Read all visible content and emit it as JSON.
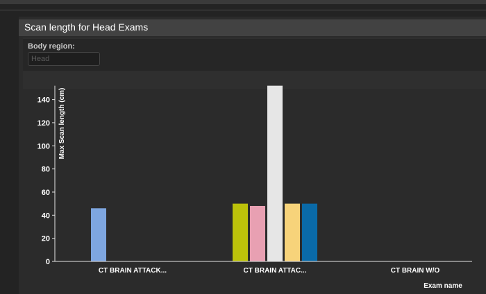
{
  "panel": {
    "title": "Scan length for Head Exams"
  },
  "filter": {
    "label": "Body region:",
    "placeholder": "Head",
    "value": ""
  },
  "colors": {
    "background": "#232323",
    "panel": "#2b2b2b",
    "header": "#424242",
    "axis": "#e6e6e6"
  },
  "chart_data": {
    "type": "bar",
    "title": "",
    "xlabel": "Exam name",
    "ylabel": "Max Scan length (cm)",
    "ylim": [
      0,
      152
    ],
    "yticks": [
      0,
      20,
      40,
      60,
      80,
      100,
      120,
      140
    ],
    "categories": [
      "CT BRAIN ATTACK...",
      "CT BRAIN ATTAC...",
      "CT BRAIN W/O"
    ],
    "grid": false,
    "legend": "none",
    "bars": [
      {
        "category": 0,
        "value": 46,
        "color": "#7ea6e0"
      },
      {
        "category": 1,
        "value": 50,
        "color": "#bcc20a"
      },
      {
        "category": 1,
        "value": 48,
        "color": "#e8a0b2"
      },
      {
        "category": 1,
        "value": 152,
        "color": "#e6e6e6"
      },
      {
        "category": 1,
        "value": 50,
        "color": "#f7d37a"
      },
      {
        "category": 1,
        "value": 50,
        "color": "#0a6aa8"
      }
    ]
  }
}
